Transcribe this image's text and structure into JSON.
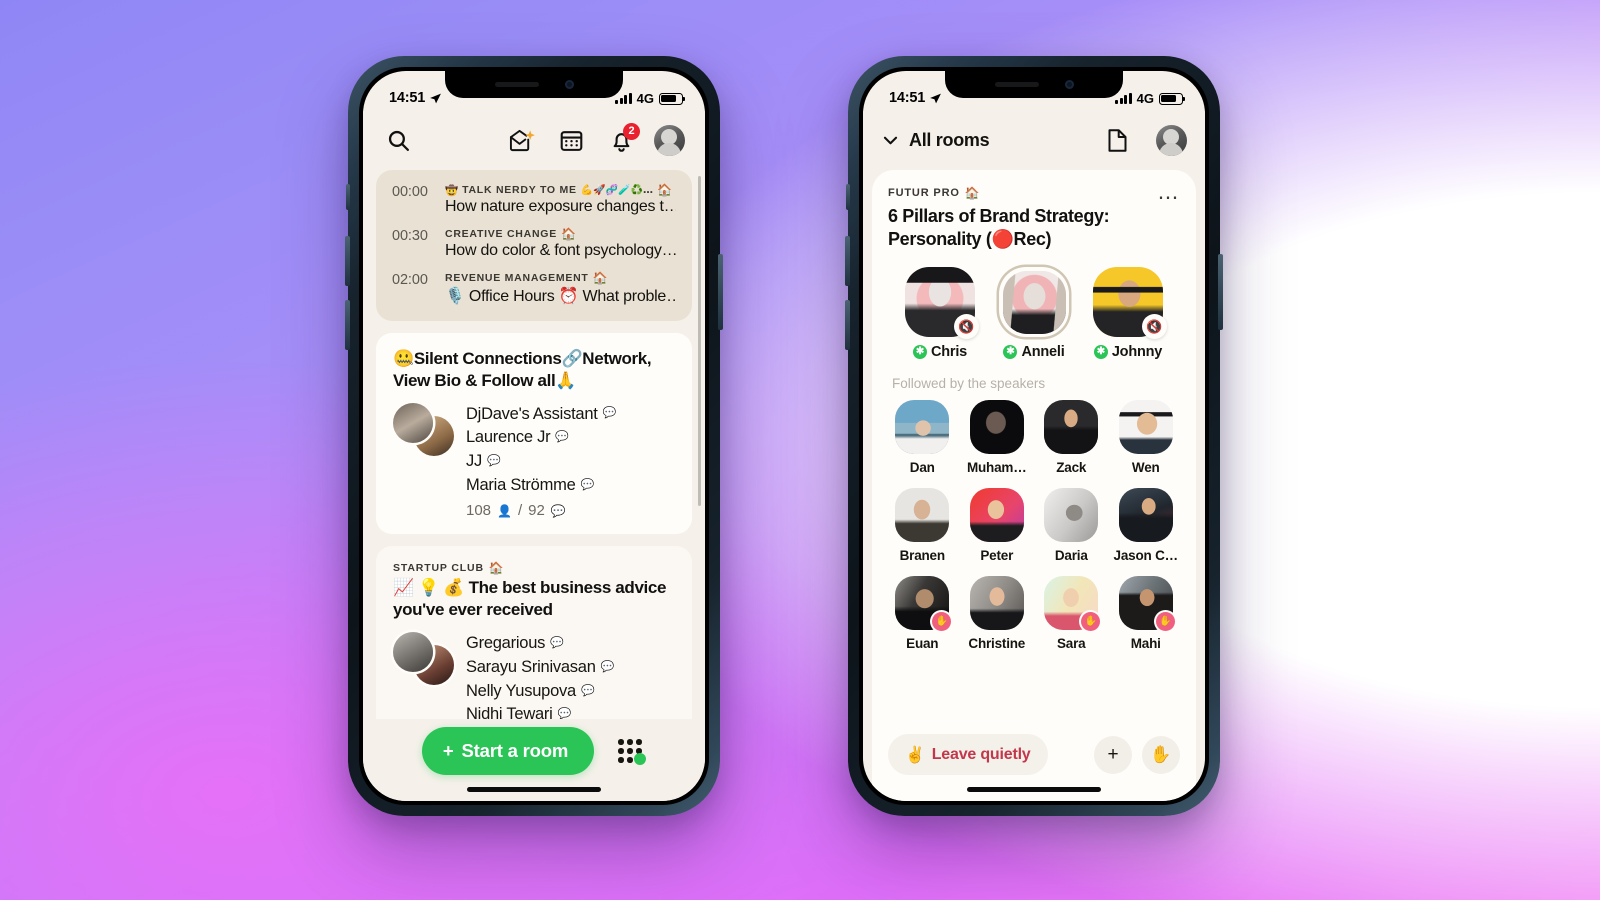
{
  "background": {
    "gradient_from": "#8f86f5",
    "gradient_mid": "#c27bf7",
    "gradient_to": "#ec6ef8",
    "right_panel": "#ffffff"
  },
  "accent": {
    "green": "#2bc457",
    "red_badge": "#e9212e",
    "leave_red": "#c2384b",
    "hand_pink": "#f0607e",
    "app_bg": "#f5f1ea",
    "card_bg": "#fffdfa"
  },
  "status_bar": {
    "time": "14:51",
    "location_icon": "location-arrow-icon",
    "network": "4G",
    "signal_icon": "signal-bars-icon",
    "battery_icon": "battery-icon"
  },
  "left_phone": {
    "header": {
      "search_icon": "search-icon",
      "invite_icon": "envelope-sparkle-icon",
      "calendar_icon": "calendar-icon",
      "bell_icon": "bell-icon",
      "bell_badge": "2",
      "avatar_icon": "user-avatar"
    },
    "schedule": [
      {
        "time": "00:00",
        "club": "TALK NERDY TO ME",
        "club_emoji": "🤠",
        "trailing_emoji": "💪🚀🧬🧪♻️…",
        "house": true,
        "title": "How nature exposure changes t…"
      },
      {
        "time": "00:30",
        "club": "CREATIVE CHANGE",
        "club_emoji": "",
        "trailing_emoji": "",
        "house": true,
        "title": "How do color & font psychology…"
      },
      {
        "time": "02:00",
        "club": "REVENUE MANAGEMENT",
        "club_emoji": "",
        "trailing_emoji": "",
        "house": true,
        "title": "🎙️ Office Hours ⏰ What proble…"
      }
    ],
    "rooms": [
      {
        "club": "",
        "house": false,
        "title": "🤐Silent Connections🔗Network, View Bio & Follow all🙏",
        "speakers": [
          "DjDave's Assistant",
          "Laurence Jr",
          "JJ",
          "Maria Strömme"
        ],
        "members_count": "108",
        "speakers_count": "92",
        "members_icon": "person-icon",
        "speakers_icon": "speech-bubble-icon"
      },
      {
        "club": "STARTUP CLUB",
        "house": true,
        "title": "📈 💡 💰 The best business advice you've ever received",
        "speakers": [
          "Gregarious",
          "Sarayu Srinivasan",
          "Nelly Yusupova",
          "Nidhi Tewari"
        ],
        "members_count": "",
        "speakers_count": "",
        "members_icon": "person-icon",
        "speakers_icon": "speech-bubble-icon"
      }
    ],
    "bottom_bar": {
      "start_room_label": "Start a room",
      "plus_icon": "plus-icon",
      "grid_icon": "hallway-grid-icon"
    }
  },
  "right_phone": {
    "header": {
      "chevron_icon": "chevron-down-icon",
      "all_rooms_label": "All rooms",
      "notes_icon": "document-icon",
      "avatar_icon": "user-avatar"
    },
    "room": {
      "club": "FUTUR PRO",
      "house": true,
      "title": "6 Pillars of Brand Strategy: Personality (🔴Rec)",
      "kebab_icon": "more-options-icon",
      "speakers": [
        {
          "name": "Chris",
          "muted": true,
          "talking": false,
          "badge": "star-badge"
        },
        {
          "name": "Anneli",
          "muted": false,
          "talking": true,
          "badge": "star-badge"
        },
        {
          "name": "Johnny",
          "muted": true,
          "talking": false,
          "badge": "star-badge"
        }
      ],
      "followed_label": "Followed by the speakers",
      "audience": [
        {
          "name": "Dan",
          "hand": false
        },
        {
          "name": "Muham…",
          "hand": false
        },
        {
          "name": "Zack",
          "hand": false
        },
        {
          "name": "Wen",
          "hand": false
        },
        {
          "name": "Branen",
          "hand": false
        },
        {
          "name": "Peter",
          "hand": false
        },
        {
          "name": "Daria",
          "hand": false
        },
        {
          "name": "Jason C…",
          "hand": false
        },
        {
          "name": "Euan",
          "hand": true
        },
        {
          "name": "Christine",
          "hand": false
        },
        {
          "name": "Sara",
          "hand": true
        },
        {
          "name": "Mahi",
          "hand": true
        }
      ]
    },
    "bottom_bar": {
      "leave_label": "Leave quietly",
      "leave_emoji": "✌️",
      "plus_icon": "plus-icon",
      "raise_hand_icon": "raised-hand-icon"
    }
  }
}
